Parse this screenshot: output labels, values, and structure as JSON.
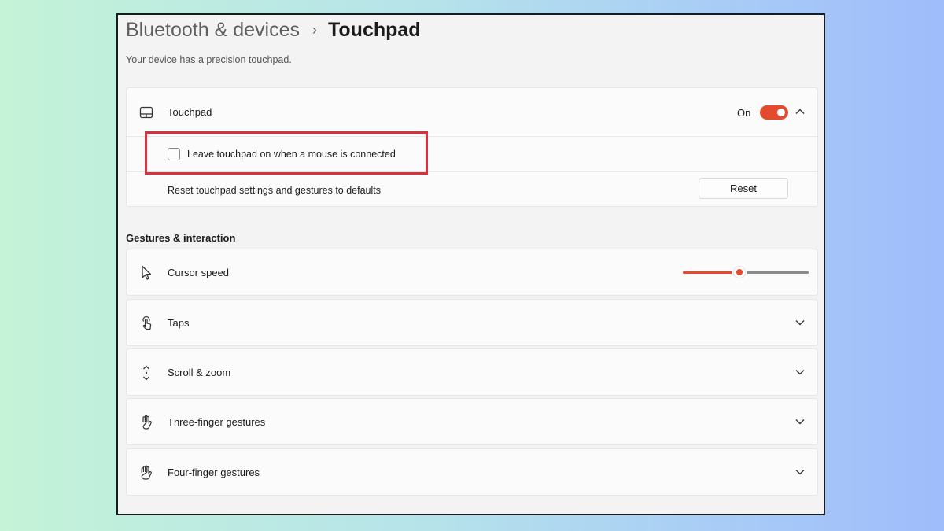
{
  "breadcrumb": {
    "parent": "Bluetooth & devices",
    "separator": "›",
    "current": "Touchpad"
  },
  "subtitle": "Your device has a precision touchpad.",
  "touchpad_card": {
    "label": "Touchpad",
    "icon": "touchpad-icon",
    "toggle_state_text": "On",
    "toggle_on": true,
    "expanded": true,
    "leave_on_label": "Leave touchpad on when a mouse is connected",
    "leave_on_checked": false,
    "reset_label": "Reset touchpad settings and gestures to defaults",
    "reset_button": "Reset"
  },
  "gestures_section_title": "Gestures & interaction",
  "gesture_items": [
    {
      "label": "Cursor speed",
      "icon": "cursor-arrow-icon",
      "control": "slider",
      "slider_value_fraction": 0.45
    },
    {
      "label": "Taps",
      "icon": "tap-finger-icon",
      "control": "expander"
    },
    {
      "label": "Scroll & zoom",
      "icon": "scroll-arrows-icon",
      "control": "expander"
    },
    {
      "label": "Three-finger gestures",
      "icon": "hand-icon",
      "control": "expander"
    },
    {
      "label": "Four-finger gestures",
      "icon": "hand-icon",
      "control": "expander"
    }
  ],
  "colors": {
    "accent": "#e34a2e",
    "highlight_box": "#d8333c"
  }
}
